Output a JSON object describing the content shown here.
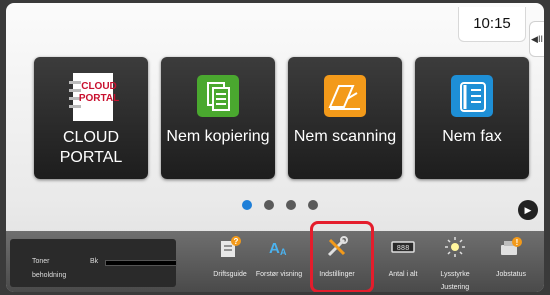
{
  "status": {
    "time": "10:15"
  },
  "home": {
    "tiles": [
      {
        "label": "CLOUD PORTAL",
        "icon": "cloud-portal-icon"
      },
      {
        "label": "Nem kopiering",
        "icon": "copy-icon"
      },
      {
        "label": "Nem scanning",
        "icon": "scan-icon"
      },
      {
        "label": "Nem fax",
        "icon": "fax-icon"
      }
    ],
    "cloud_logo_text": "CLOUD PORTAL",
    "page_indicator": {
      "pages": 4,
      "current": 1
    }
  },
  "bottombar": {
    "toner": {
      "label_line1": "Toner",
      "label_line2": "beholdning",
      "color": "Bk",
      "level": 1.0
    },
    "functions": [
      {
        "label": "Driftsguide",
        "icon": "operation-guide-icon"
      },
      {
        "label": "Forstør visning",
        "icon": "enlarge-display-icon"
      },
      {
        "label": "Indstillinger",
        "icon": "settings-icon"
      },
      {
        "label": "Antal i alt",
        "icon": "total-count-icon"
      },
      {
        "label": "Lysstyrke Justering",
        "icon": "brightness-icon"
      },
      {
        "label": "Jobstatus",
        "icon": "job-status-icon"
      }
    ],
    "highlighted": "Indstillinger"
  },
  "colors": {
    "accent_blue": "#1e7fd8",
    "highlight_red": "#e41d2c",
    "copy_green": "#4aa82f",
    "scan_orange": "#f39a1a",
    "fax_blue": "#1e8fd6",
    "cloud_red": "#c8102e"
  }
}
